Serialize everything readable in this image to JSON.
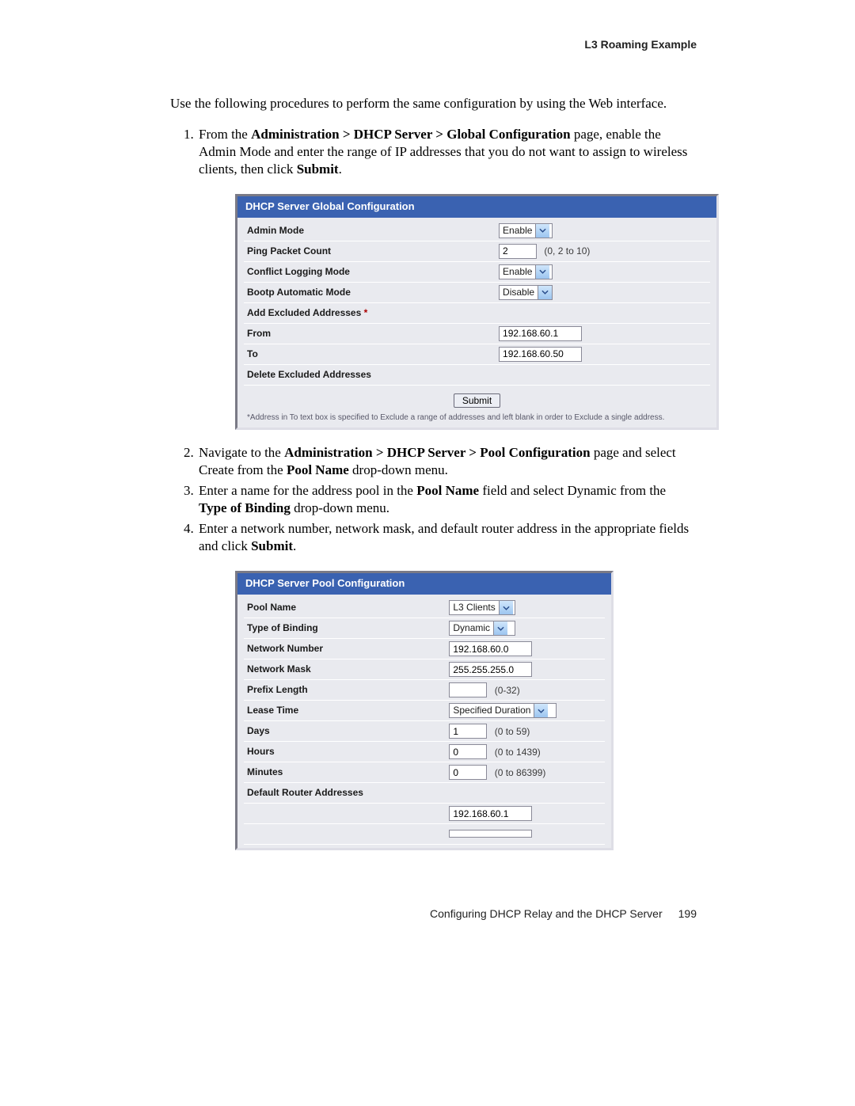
{
  "header": {
    "section_title": "L3 Roaming Example"
  },
  "intro": "Use the following procedures to perform the same configuration by using the Web interface.",
  "step1": {
    "pre": "From the ",
    "bold_path": "Administration > DHCP Server > Global Configuration",
    "mid": " page, enable the Admin Mode and enter the range of IP addresses that you do not want to assign to wireless clients, then click ",
    "bold2": "Submit",
    "post": "."
  },
  "panel1": {
    "title": "DHCP Server Global Configuration",
    "rows": {
      "admin_mode_label": "Admin Mode",
      "admin_mode_value": "Enable",
      "ping_label": "Ping Packet Count",
      "ping_value": "2",
      "ping_hint": "(0, 2 to 10)",
      "conflict_label": "Conflict Logging Mode",
      "conflict_value": "Enable",
      "bootp_label": "Bootp Automatic Mode",
      "bootp_value": "Disable",
      "add_excl_label": "Add Excluded Addresses",
      "from_label": "From",
      "from_value": "192.168.60.1",
      "to_label": "To",
      "to_value": "192.168.60.50",
      "del_excl_label": "Delete Excluded Addresses"
    },
    "submit_label": "Submit",
    "footnote": "Address in To text box is specified to Exclude a range of addresses and left blank in order to Exclude a single address."
  },
  "step2": {
    "pre": "Navigate to the ",
    "bold_path": "Administration > DHCP Server > Pool Configuration",
    "mid": " page and select Create from the ",
    "bold2": "Pool Name",
    "post": " drop-down menu."
  },
  "step3": {
    "pre": "Enter a name for the address pool in the ",
    "bold1": "Pool Name",
    "mid": " field and select Dynamic from the ",
    "bold2": "Type of Binding",
    "post": " drop-down menu."
  },
  "step4": {
    "pre": "Enter a network number, network mask, and default router address in the appropriate fields and click ",
    "bold1": "Submit",
    "post": "."
  },
  "panel2": {
    "title": "DHCP Server Pool Configuration",
    "rows": {
      "pool_label": "Pool Name",
      "pool_value": "L3 Clients",
      "bind_label": "Type of Binding",
      "bind_value": "Dynamic",
      "netnum_label": "Network Number",
      "netnum_value": "192.168.60.0",
      "mask_label": "Network Mask",
      "mask_value": "255.255.255.0",
      "prefix_label": "Prefix Length",
      "prefix_value": "",
      "prefix_hint": "(0-32)",
      "lease_label": "Lease Time",
      "lease_value": "Specified Duration",
      "days_label": "Days",
      "days_value": "1",
      "days_hint": "(0 to 59)",
      "hours_label": "Hours",
      "hours_value": "0",
      "hours_hint": "(0 to 1439)",
      "mins_label": "Minutes",
      "mins_value": "0",
      "mins_hint": "(0 to 86399)",
      "router_label": "Default Router Addresses",
      "router_value": "192.168.60.1"
    }
  },
  "footer": {
    "text": "Configuring DHCP Relay and the DHCP Server",
    "page": "199"
  }
}
